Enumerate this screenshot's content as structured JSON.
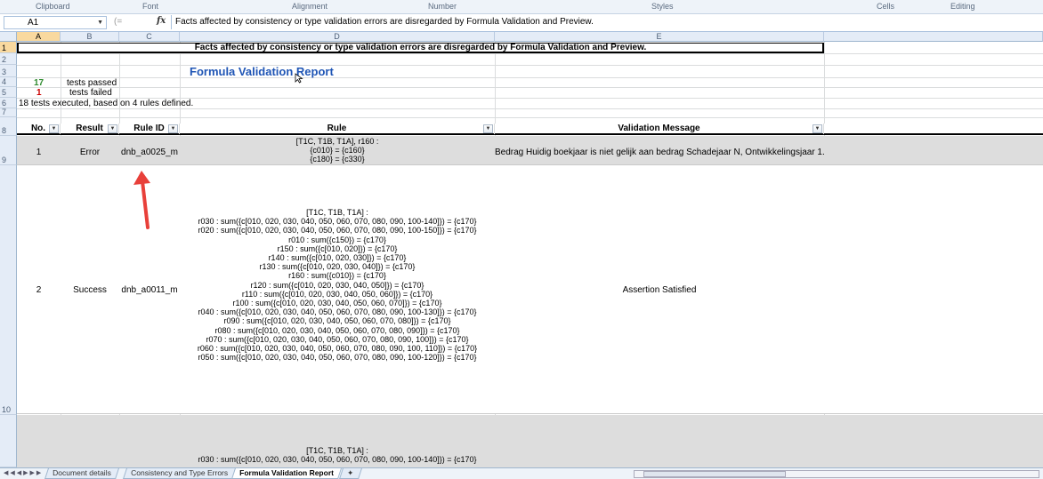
{
  "ribbon": {
    "groups": [
      "Clipboard",
      "Font",
      "Alignment",
      "Number",
      "Styles",
      "Cells",
      "Editing"
    ]
  },
  "formula_bar": {
    "name_box": "A1",
    "fx": "fx",
    "formula": "Facts affected by consistency or type validation errors are disregarded by Formula Validation and Preview."
  },
  "columns": [
    "A",
    "B",
    "C",
    "D",
    "E"
  ],
  "rows": [
    "1",
    "2",
    "3",
    "4",
    "5",
    "6",
    "7",
    "8",
    "9",
    "10"
  ],
  "sheet": {
    "banner": "Facts affected by consistency or type validation errors are disregarded by Formula Validation and Preview.",
    "title": "Formula Validation Report",
    "passed_count": "17",
    "passed_label": "tests passed",
    "failed_count": "1",
    "failed_label": "tests failed",
    "summary": "18 tests executed, based on 4 rules defined.",
    "headers": {
      "no": "No.",
      "result": "Result",
      "rule_id": "Rule ID",
      "rule": "Rule",
      "message": "Validation Message"
    },
    "records": [
      {
        "no": "1",
        "result": "Error",
        "rule_id": "dnb_a0025_m",
        "rule_lines": [
          "[T1C, T1B, T1A], r160 :",
          "{c010} = {c160}",
          "{c180} = {c330}"
        ],
        "message": "Bedrag Huidig boekjaar is niet gelijk aan bedrag Schadejaar N, Ontwikkelingsjaar 1."
      },
      {
        "no": "2",
        "result": "Success",
        "rule_id": "dnb_a0011_m",
        "rule_lines": [
          "[T1C, T1B, T1A] :",
          "r030 : sum({c[010, 020, 030, 040, 050, 060, 070, 080, 090, 100-140]}) = {c170}",
          "r020 : sum({c[010, 020, 030, 040, 050, 060, 070, 080, 090, 100-150]}) = {c170}",
          "r010 : sum({c150}) = {c170}",
          "r150 : sum({c[010, 020]}) = {c170}",
          "r140 : sum({c[010, 020, 030]}) = {c170}",
          "r130 : sum({c[010, 020, 030, 040]}) = {c170}",
          "r160 : sum({c010}) = {c170}",
          "r120 : sum({c[010, 020, 030, 040, 050]}) = {c170}",
          "r110 : sum({c[010, 020, 030, 040, 050, 060]}) = {c170}",
          "r100 : sum({c[010, 020, 030, 040, 050, 060, 070]}) = {c170}",
          "r040 : sum({c[010, 020, 030, 040, 050, 060, 070, 080, 090, 100-130]}) = {c170}",
          "r090 : sum({c[010, 020, 030, 040, 050, 060, 070, 080]}) = {c170}",
          "r080 : sum({c[010, 020, 030, 040, 050, 060, 070, 080, 090]}) = {c170}",
          "r070 : sum({c[010, 020, 030, 040, 050, 060, 070, 080, 090, 100]}) = {c170}",
          "r060 : sum({c[010, 020, 030, 040, 050, 060, 070, 080, 090, 100, 110]}) = {c170}",
          "r050 : sum({c[010, 020, 030, 040, 050, 060, 070, 080, 090, 100-120]}) = {c170}"
        ],
        "message": "Assertion Satisfied"
      },
      {
        "rule_lines": [
          "[T1C, T1B, T1A] :",
          "r030 : sum({c[010, 020, 030, 040, 050, 060, 070, 080, 090, 100-140]}) = {c170}"
        ]
      }
    ]
  },
  "tabs": [
    "Document details",
    "Consistency and Type Errors",
    "Formula Validation Report"
  ],
  "colors": {
    "title": "#1f55b5",
    "passed": "#2e8b2e",
    "failed": "#cc0000",
    "arrow": "#e8403a",
    "selected_header": "#f9d99f"
  }
}
